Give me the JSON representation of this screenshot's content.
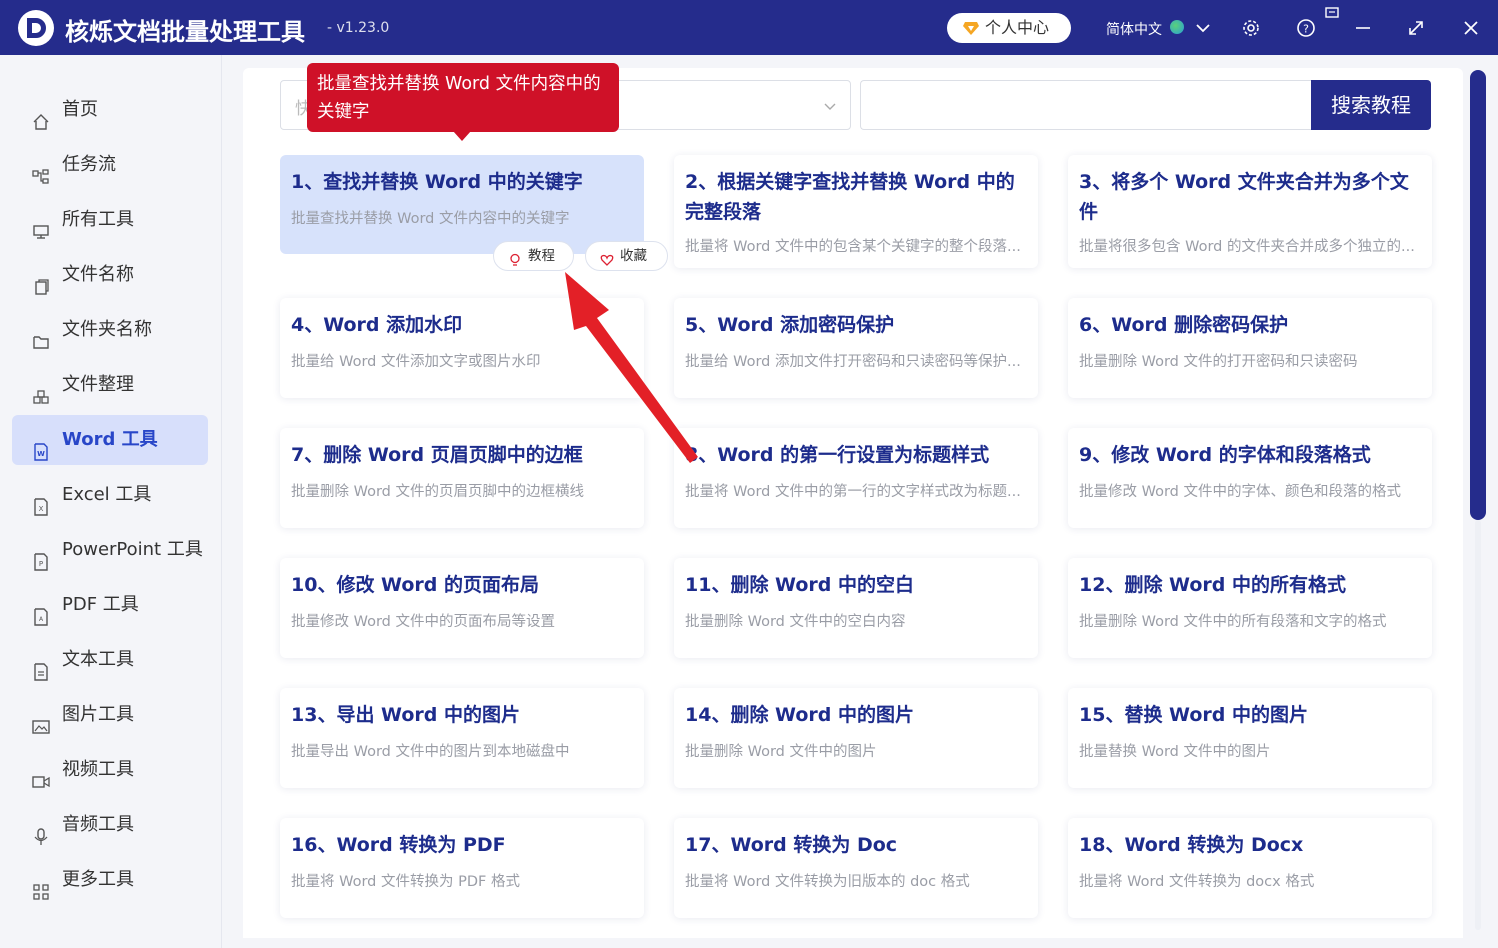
{
  "app": {
    "title": "核烁文档批量处理工具",
    "version": "- v1.23.0",
    "user_center": "个人中心",
    "language": "简体中文"
  },
  "sidebar": {
    "items": [
      {
        "label": "首页",
        "icon": "home-icon"
      },
      {
        "label": "任务流",
        "icon": "workflow-icon"
      },
      {
        "label": "所有工具",
        "icon": "monitor-icon"
      },
      {
        "label": "文件名称",
        "icon": "file-copy-icon"
      },
      {
        "label": "文件夹名称",
        "icon": "folder-icon"
      },
      {
        "label": "文件整理",
        "icon": "organize-icon"
      },
      {
        "label": "Word 工具",
        "icon": "word-file-icon",
        "active": true
      },
      {
        "label": "Excel 工具",
        "icon": "excel-file-icon"
      },
      {
        "label": "PowerPoint 工具",
        "icon": "ppt-file-icon"
      },
      {
        "label": "PDF 工具",
        "icon": "pdf-file-icon"
      },
      {
        "label": "文本工具",
        "icon": "text-file-icon"
      },
      {
        "label": "图片工具",
        "icon": "image-icon"
      },
      {
        "label": "视频工具",
        "icon": "video-icon"
      },
      {
        "label": "音频工具",
        "icon": "microphone-icon"
      },
      {
        "label": "更多工具",
        "icon": "grid-icon"
      }
    ]
  },
  "search": {
    "select_placeholder": "快",
    "input_value": "",
    "button": "搜索教程"
  },
  "tooltip": "批量查找并替换 Word 文件内容中的关键字",
  "card_actions": {
    "tutorial": "教程",
    "favorite": "收藏"
  },
  "cards": [
    {
      "title": "1、查找并替换 Word 中的关键字",
      "desc": "批量查找并替换 Word 文件内容中的关键字"
    },
    {
      "title": "2、根据关键字查找并替换 Word 中的完整段落",
      "desc": "批量将 Word 文件中的包含某个关键字的整个段落..."
    },
    {
      "title": "3、将多个 Word 文件夹合并为多个文件",
      "desc": "批量将很多包含 Word 的文件夹合并成多个独立的..."
    },
    {
      "title": "4、Word 添加水印",
      "desc": "批量给 Word 文件添加文字或图片水印"
    },
    {
      "title": "5、Word 添加密码保护",
      "desc": "批量给 Word 添加文件打开密码和只读密码等保护..."
    },
    {
      "title": "6、Word 删除密码保护",
      "desc": "批量删除 Word 文件的打开密码和只读密码"
    },
    {
      "title": "7、删除 Word 页眉页脚中的边框",
      "desc": "批量删除 Word 文件的页眉页脚中的边框横线"
    },
    {
      "title": "8、Word 的第一行设置为标题样式",
      "desc": "批量将 Word 文件中的第一行的文字样式改为标题..."
    },
    {
      "title": "9、修改 Word 的字体和段落格式",
      "desc": "批量修改 Word 文件中的字体、颜色和段落的格式"
    },
    {
      "title": "10、修改 Word 的页面布局",
      "desc": "批量修改 Word 文件中的页面布局等设置"
    },
    {
      "title": "11、删除 Word 中的空白",
      "desc": "批量删除 Word 文件中的空白内容"
    },
    {
      "title": "12、删除 Word 中的所有格式",
      "desc": "批量删除 Word 文件中的所有段落和文字的格式"
    },
    {
      "title": "13、导出 Word 中的图片",
      "desc": "批量导出 Word 文件中的图片到本地磁盘中"
    },
    {
      "title": "14、删除 Word 中的图片",
      "desc": "批量删除 Word 文件中的图片"
    },
    {
      "title": "15、替换 Word 中的图片",
      "desc": "批量替换 Word 文件中的图片"
    },
    {
      "title": "16、Word 转换为 PDF",
      "desc": "批量将 Word 文件转换为 PDF 格式"
    },
    {
      "title": "17、Word 转换为 Doc",
      "desc": "批量将 Word 文件转换为旧版本的 doc 格式"
    },
    {
      "title": "18、Word 转换为 Docx",
      "desc": "批量将 Word 文件转换为 docx 格式"
    }
  ],
  "colors": {
    "brand": "#252c8c",
    "accent": "#2846c8",
    "tooltip": "#cf1128",
    "highlight_card": "#d7e2fb"
  }
}
